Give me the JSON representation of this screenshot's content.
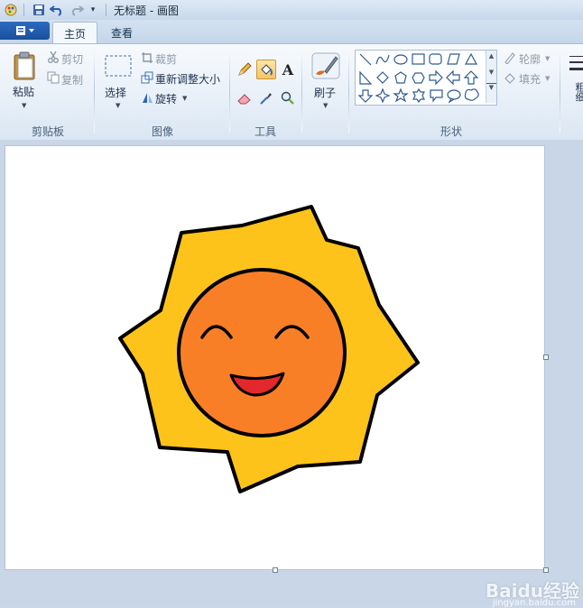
{
  "window": {
    "title": "无标题 - 画图"
  },
  "quick_access": [
    "save-icon",
    "undo-icon",
    "redo-icon",
    "customize-icon"
  ],
  "tabs": [
    {
      "label": "主页",
      "active": true
    },
    {
      "label": "查看",
      "active": false
    }
  ],
  "clipboard": {
    "paste_label": "粘贴",
    "cut_label": "剪切",
    "copy_label": "复制",
    "group_label": "剪贴板"
  },
  "image": {
    "select_label": "选择",
    "crop_label": "裁剪",
    "resize_label": "重新调整大小",
    "rotate_label": "旋转",
    "group_label": "图像"
  },
  "tools": {
    "group_label": "工具",
    "active_tool": "fill"
  },
  "brushes": {
    "label": "刷子"
  },
  "shapes": {
    "group_label": "形状",
    "outline_label": "轮廓",
    "fill_label": "填充"
  },
  "size": {
    "label_partial": "粗细"
  },
  "canvas": {
    "background": "#ffffff",
    "drawing": "smiling-sun",
    "colors": {
      "rays": "#fdc31a",
      "face": "#f97f27",
      "mouth": "#e0282d",
      "outline": "#000000"
    }
  },
  "watermark": {
    "text": "Baidu经验",
    "sub": "jingyan.baidu.com"
  }
}
